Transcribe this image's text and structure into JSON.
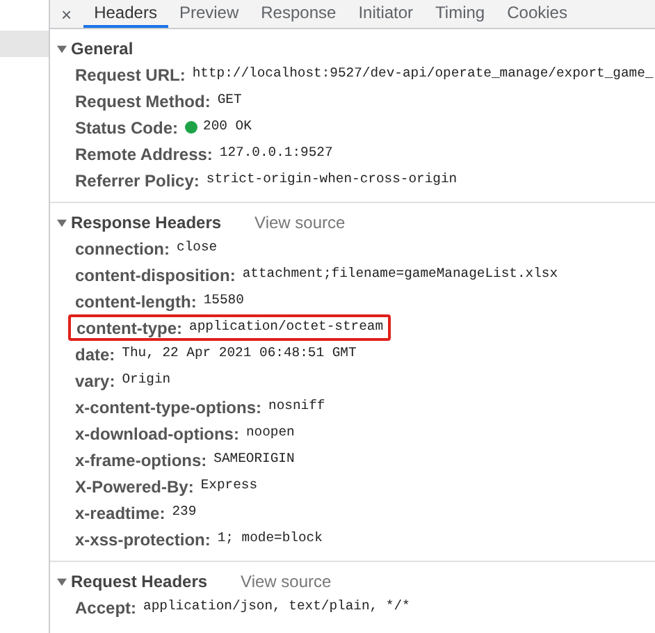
{
  "close_button": {
    "label": "×"
  },
  "tabs": [
    {
      "label": "Headers",
      "selected": true
    },
    {
      "label": "Preview",
      "selected": false
    },
    {
      "label": "Response",
      "selected": false
    },
    {
      "label": "Initiator",
      "selected": false
    },
    {
      "label": "Timing",
      "selected": false
    },
    {
      "label": "Cookies",
      "selected": false
    }
  ],
  "sections": [
    {
      "title": "General",
      "expanded": true,
      "rows": [
        {
          "name": "Request URL:",
          "value": "http://localhost:9527/dev-api/operate_manage/export_game_",
          "highlighted": false
        },
        {
          "name": "Request Method:",
          "value": "GET",
          "highlighted": false
        },
        {
          "name": "Status Code:",
          "value": "200 OK",
          "kind": "status",
          "color": "#1ea446",
          "highlighted": false
        },
        {
          "name": "Remote Address:",
          "value": "127.0.0.1:9527",
          "highlighted": false
        },
        {
          "name": "Referrer Policy:",
          "value": "strict-origin-when-cross-origin",
          "highlighted": false
        }
      ]
    },
    {
      "title": "Response Headers",
      "view_source": "View source",
      "expanded": true,
      "rows": [
        {
          "name": "connection:",
          "value": "close",
          "highlighted": false
        },
        {
          "name": "content-disposition:",
          "value": "attachment;filename=gameManageList.xlsx",
          "highlighted": false
        },
        {
          "name": "content-length:",
          "value": "15580",
          "highlighted": false
        },
        {
          "name": "content-type:",
          "value": "application/octet-stream",
          "highlighted": true
        },
        {
          "name": "date:",
          "value": "Thu, 22 Apr 2021 06:48:51 GMT",
          "highlighted": false
        },
        {
          "name": "vary:",
          "value": "Origin",
          "highlighted": false
        },
        {
          "name": "x-content-type-options:",
          "value": "nosniff",
          "highlighted": false
        },
        {
          "name": "x-download-options:",
          "value": "noopen",
          "highlighted": false
        },
        {
          "name": "x-frame-options:",
          "value": "SAMEORIGIN",
          "highlighted": false
        },
        {
          "name": "X-Powered-By:",
          "value": "Express",
          "highlighted": false
        },
        {
          "name": "x-readtime:",
          "value": "239",
          "highlighted": false
        },
        {
          "name": "x-xss-protection:",
          "value": "1; mode=block",
          "highlighted": false
        }
      ]
    },
    {
      "title": "Request Headers",
      "view_source": "View source",
      "expanded": true,
      "rows": [
        {
          "name": "Accept:",
          "value": "application/json, text/plain, */*",
          "highlighted": false
        }
      ]
    }
  ]
}
